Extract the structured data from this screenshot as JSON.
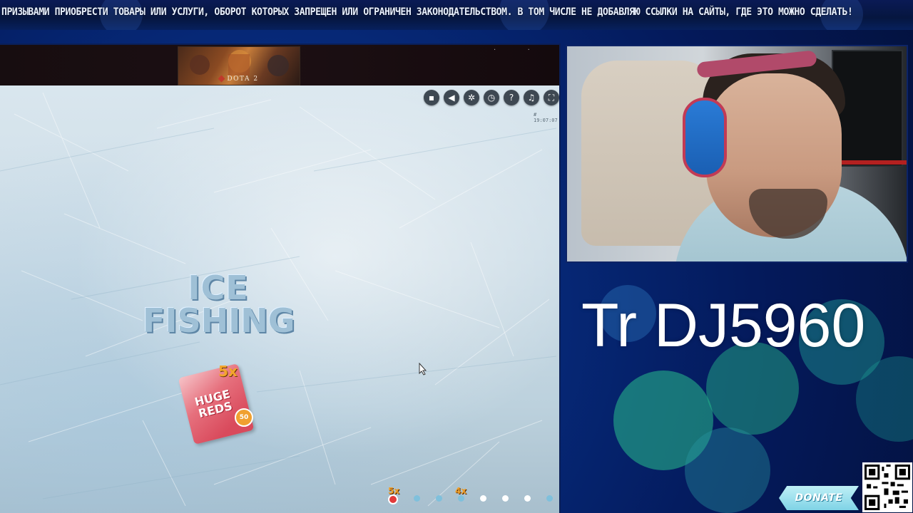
{
  "ticker": {
    "text": "ПРИЗЫВАМИ ПРИОБРЕСТИ ТОВАРЫ ИЛИ УСЛУГИ, ОБОРОТ КОТОРЫХ ЗАПРЕЩЕН ИЛИ ОГРАНИЧЕН ЗАКОНОДАТЕЛЬСТВОМ. В ТОМ ЧИСЛЕ НЕ ДОБАВЛЯЮ ССЫЛКИ НА САЙТЫ, ГДЕ ЭТО МОЖНО СДЕЛАТЬ!"
  },
  "game": {
    "ad_banner_label": "DOTA 2",
    "toolbar_icons": [
      "chat-icon",
      "sound-icon",
      "settings-icon",
      "history-icon",
      "help-icon",
      "headset-icon",
      "fullscreen-icon"
    ],
    "toolbar_glyphs": [
      "▪",
      "◀",
      "✲",
      "◷",
      "?",
      "♫",
      "⛶"
    ],
    "clock": "# 19:07:07",
    "logo_line1": "ICE",
    "logo_line2": "FISHING",
    "bag_label_line1": "HUGE",
    "bag_label_line2": "REDS",
    "bag_multiplier": "5x",
    "bag_badge": "50",
    "track_labels": [
      "5x",
      "4x"
    ]
  },
  "stream": {
    "title": "Tr DJ5960",
    "donate_label": "DONATE"
  },
  "colors": {
    "background": "#04195a",
    "accent": "#0b3fa8",
    "ice": "#cddde7",
    "track_orange": "#f0a02a"
  }
}
